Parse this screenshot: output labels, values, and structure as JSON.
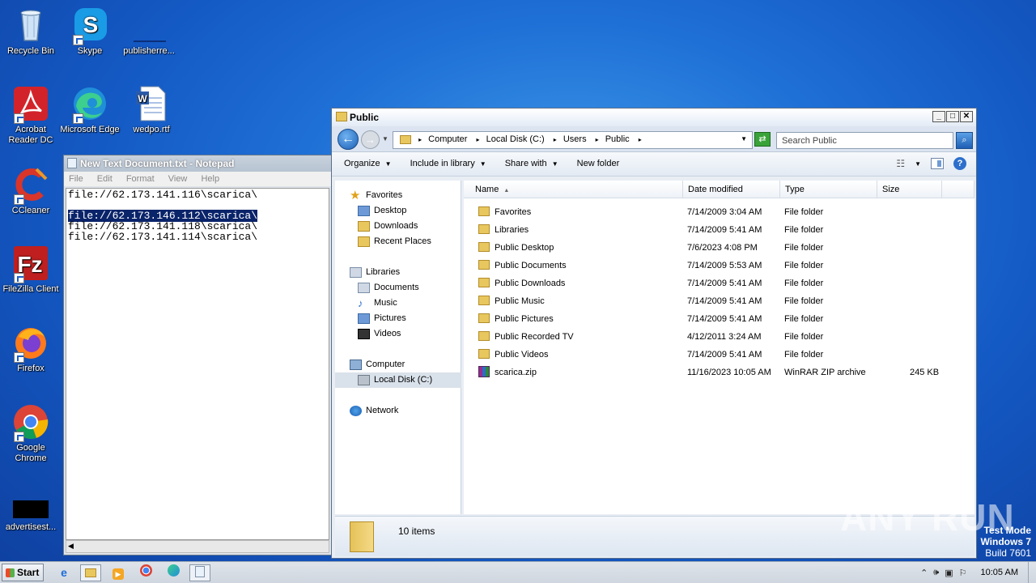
{
  "desktop": {
    "icons": [
      {
        "label": "Recycle Bin"
      },
      {
        "label": "Skype"
      },
      {
        "label": "publisherre..."
      },
      {
        "label": "Acrobat Reader DC"
      },
      {
        "label": "Microsoft Edge"
      },
      {
        "label": "wedpo.rtf"
      },
      {
        "label": "CCleaner"
      },
      {
        "label": "FileZilla Client"
      },
      {
        "label": "Firefox"
      },
      {
        "label": "Google Chrome"
      },
      {
        "label": "advertisest..."
      }
    ]
  },
  "notepad": {
    "title": "New Text Document.txt - Notepad",
    "menu": [
      "File",
      "Edit",
      "Format",
      "View",
      "Help"
    ],
    "lines": [
      "file://62.173.141.116\\scarica\\",
      "",
      "file://62.173.146.112\\scarica\\",
      "file://62.173.141.118\\scarica\\",
      "file://62.173.141.114\\scarica\\"
    ]
  },
  "explorer": {
    "title": "Public",
    "breadcrumb": [
      "Computer",
      "Local Disk (C:)",
      "Users",
      "Public"
    ],
    "search_placeholder": "Search Public",
    "toolbar": {
      "organize": "Organize",
      "include": "Include in library",
      "share": "Share with",
      "new_folder": "New folder"
    },
    "nav": {
      "favorites": "Favorites",
      "desktop": "Desktop",
      "downloads": "Downloads",
      "recent": "Recent Places",
      "libraries": "Libraries",
      "documents": "Documents",
      "music": "Music",
      "pictures": "Pictures",
      "videos": "Videos",
      "computer": "Computer",
      "local_disk": "Local Disk (C:)",
      "network": "Network"
    },
    "columns": {
      "name": "Name",
      "date": "Date modified",
      "type": "Type",
      "size": "Size"
    },
    "files": [
      {
        "name": "Favorites",
        "date": "7/14/2009 3:04 AM",
        "type": "File folder",
        "size": ""
      },
      {
        "name": "Libraries",
        "date": "7/14/2009 5:41 AM",
        "type": "File folder",
        "size": ""
      },
      {
        "name": "Public Desktop",
        "date": "7/6/2023 4:08 PM",
        "type": "File folder",
        "size": ""
      },
      {
        "name": "Public Documents",
        "date": "7/14/2009 5:53 AM",
        "type": "File folder",
        "size": ""
      },
      {
        "name": "Public Downloads",
        "date": "7/14/2009 5:41 AM",
        "type": "File folder",
        "size": ""
      },
      {
        "name": "Public Music",
        "date": "7/14/2009 5:41 AM",
        "type": "File folder",
        "size": ""
      },
      {
        "name": "Public Pictures",
        "date": "7/14/2009 5:41 AM",
        "type": "File folder",
        "size": ""
      },
      {
        "name": "Public Recorded TV",
        "date": "4/12/2011 3:24 AM",
        "type": "File folder",
        "size": ""
      },
      {
        "name": "Public Videos",
        "date": "7/14/2009 5:41 AM",
        "type": "File folder",
        "size": ""
      },
      {
        "name": "scarica.zip",
        "date": "11/16/2023 10:05 AM",
        "type": "WinRAR ZIP archive",
        "size": "245 KB"
      }
    ],
    "item_count": "10 items"
  },
  "watermark": "ANY RUN",
  "os_info": {
    "line1": "Test Mode",
    "line2": "Windows 7",
    "line3": "Build 7601"
  },
  "taskbar": {
    "start": "Start",
    "clock": "10:05 AM"
  }
}
